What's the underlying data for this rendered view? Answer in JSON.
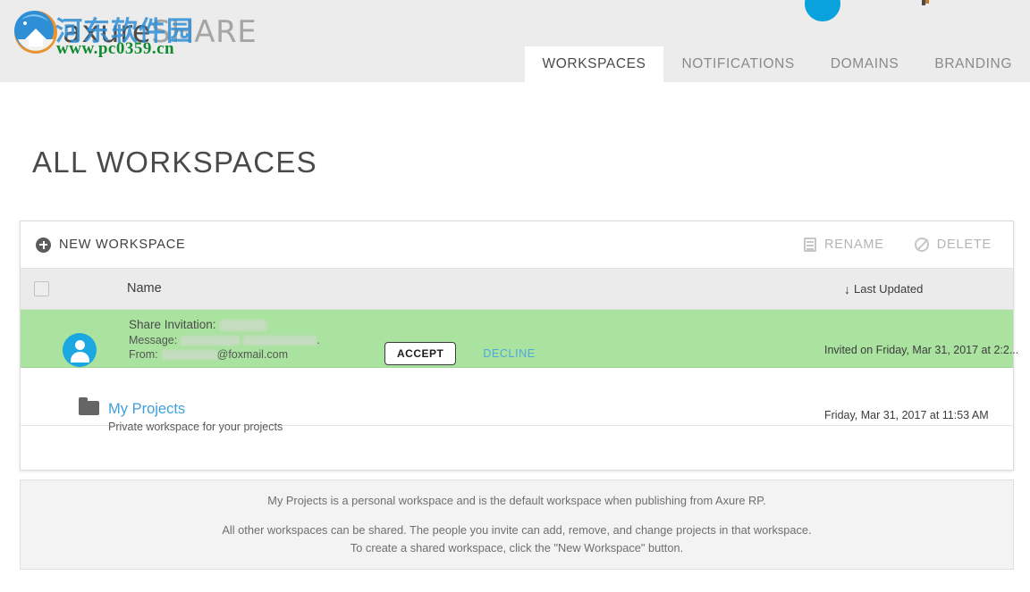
{
  "header": {
    "logo": {
      "part1": "axure",
      "part2": "SHARE"
    },
    "watermark": {
      "cn_text": "河东软件园",
      "url": "www.pc0359.cn"
    },
    "tabs": [
      {
        "label": "WORKSPACES",
        "active": true
      },
      {
        "label": "NOTIFICATIONS",
        "active": false
      },
      {
        "label": "DOMAINS",
        "active": false
      },
      {
        "label": "BRANDING",
        "active": false
      }
    ]
  },
  "page": {
    "title": "ALL WORKSPACES"
  },
  "toolbar": {
    "new_workspace": "NEW WORKSPACE",
    "rename": "RENAME",
    "delete": "DELETE"
  },
  "table": {
    "columns": {
      "name": "Name",
      "last_updated": "Last Updated",
      "sort_arrow": "↓"
    },
    "rows": [
      {
        "type": "invitation",
        "title_label": "Share Invitation:",
        "message_label": "Message:",
        "from_label": "From:",
        "from_domain": "@foxmail.com",
        "message_tail": ".",
        "accept": "ACCEPT",
        "decline": "DECLINE",
        "date": "Invited on Friday, Mar 31, 2017 at 2:2..."
      },
      {
        "type": "workspace",
        "name": "My Projects",
        "description": "Private workspace for your projects",
        "date": "Friday, Mar 31, 2017 at 11:53 AM"
      }
    ]
  },
  "note": {
    "line1": "My Projects is a personal workspace and is the default workspace when publishing from Axure RP.",
    "line2": "All other workspaces can be shared. The people you invite can add, remove, and change projects in that workspace.",
    "line3": "To create a shared workspace, click the \"New Workspace\" button."
  },
  "colors": {
    "header_bg": "#ececec",
    "tab_active_bg": "#ffffff",
    "invite_row_bg": "#aae2a0",
    "link_blue": "#3f9fd8",
    "avatar_blue": "#1ba7e0",
    "note_bg": "#f3f3f3"
  }
}
